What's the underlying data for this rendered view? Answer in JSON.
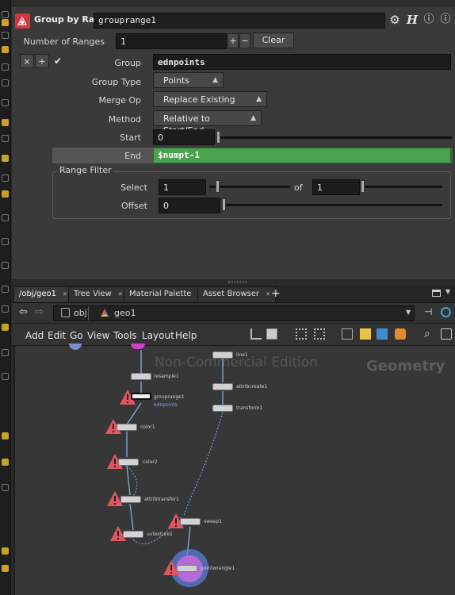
{
  "param_pane": {
    "node_type": "Group by Range",
    "node_name": "grouprange1",
    "header_icons": [
      "gear-icon",
      "help-icon",
      "info-icon"
    ],
    "number_of_ranges": {
      "label": "Number of Ranges",
      "value": "1",
      "plus": "+",
      "minus": "−",
      "clear": "Clear"
    },
    "multiparm_buttons": {
      "remove": "×",
      "add": "+",
      "toggle": "✔"
    },
    "group": {
      "label": "Group",
      "value": "ednpoints"
    },
    "group_type": {
      "label": "Group Type",
      "value": "Points"
    },
    "merge_op": {
      "label": "Merge Op",
      "value": "Replace Existing"
    },
    "method": {
      "label": "Method",
      "value": "Relative to Start/End"
    },
    "start": {
      "label": "Start",
      "value": "0"
    },
    "end": {
      "label": "End",
      "value": "$numpt-1"
    },
    "range_filter": {
      "title": "Range Filter",
      "select_label": "Select",
      "select_value": "1",
      "of_label": "of",
      "of_value": "1",
      "offset_label": "Offset",
      "offset_value": "0"
    }
  },
  "tabs": [
    {
      "label": "/obj/geo1",
      "active": true
    },
    {
      "label": "Tree View"
    },
    {
      "label": "Material Palette"
    },
    {
      "label": "Asset Browser"
    }
  ],
  "add_tab": "+",
  "path": {
    "root": "obj",
    "current": "geo1"
  },
  "network_menu": [
    "Add",
    "Edit",
    "Go",
    "View",
    "Tools",
    "Layout",
    "Help"
  ],
  "canvas": {
    "watermark": "Non-Commercial Edition",
    "context": "Geometry",
    "nodes": {
      "top_partial": "...er",
      "resample": "resample1",
      "grouprange": "grouprange1",
      "grouprange_group": "ednpoints",
      "color1": "color1",
      "color2": "color2",
      "attribtransfer": "attribtransfer1",
      "uvtexture": "uvtexture1",
      "line": "line1",
      "attribcreate": "attribcreate1",
      "transform": "transform1",
      "sweep": "sweep1",
      "pointwrangle": "pointwrangle1"
    }
  },
  "colors": {
    "end_field": "#4aa24f",
    "node_icon": "#d3363c",
    "warning": "#e05560",
    "shelf_accent": "#c9a227"
  }
}
